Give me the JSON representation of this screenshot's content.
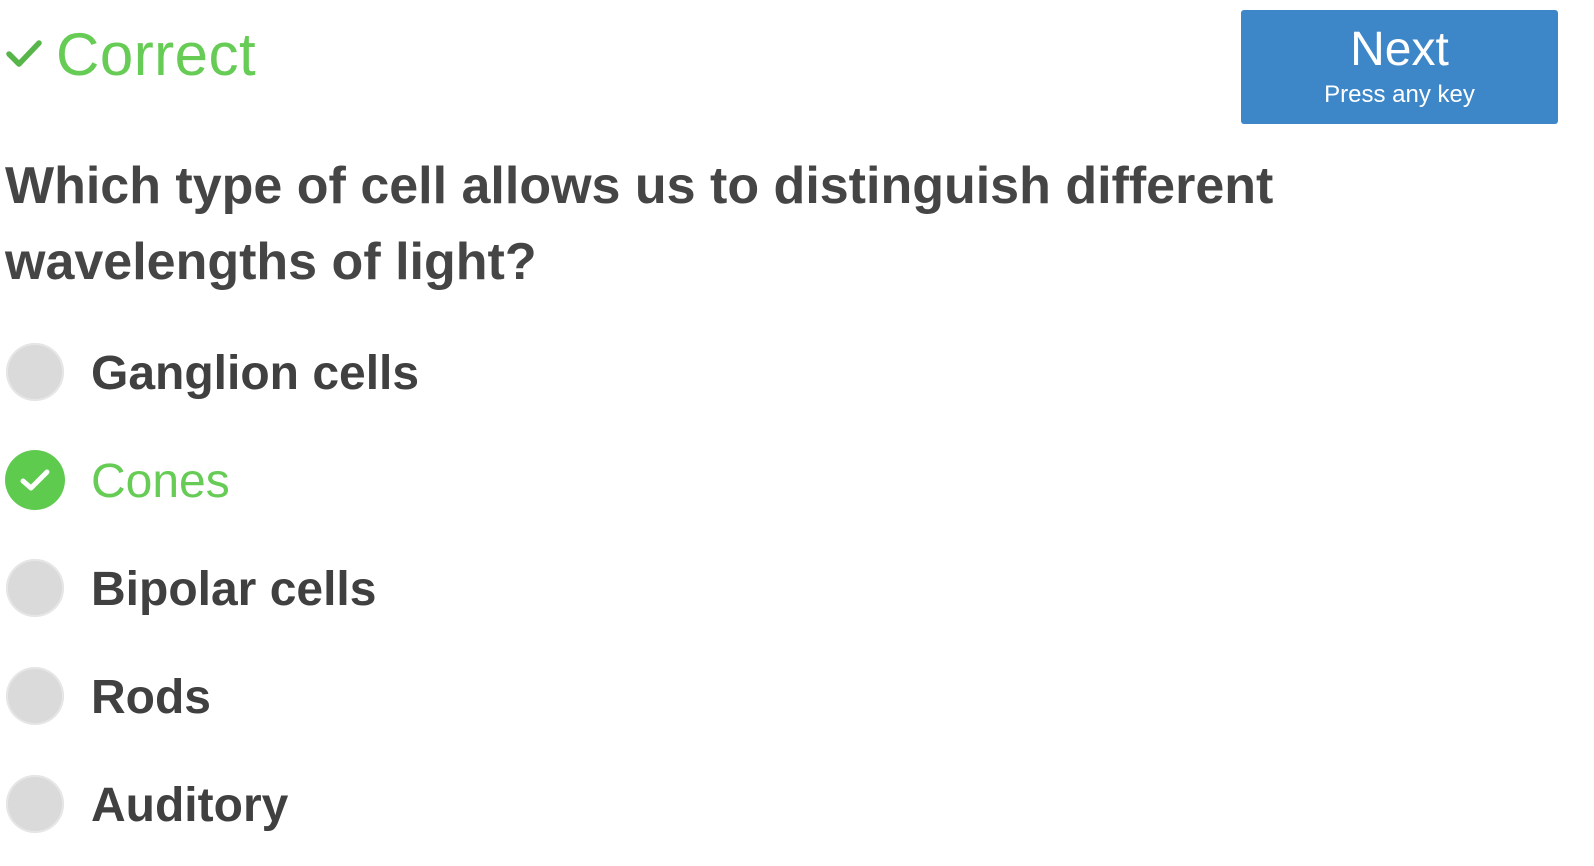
{
  "status": {
    "text": "Correct",
    "icon": "checkmark-icon",
    "color": "#66cc55"
  },
  "next_button": {
    "label": "Next",
    "hint": "Press any key",
    "color": "#3d87c9"
  },
  "question": {
    "text": "Which type of cell allows us to distinguish different wavelengths of light?"
  },
  "options": [
    {
      "label": "Ganglion cells",
      "selected": false
    },
    {
      "label": "Cones",
      "selected": true,
      "correct": true
    },
    {
      "label": "Bipolar cells",
      "selected": false
    },
    {
      "label": "Rods",
      "selected": false
    },
    {
      "label": "Auditory",
      "selected": false
    }
  ],
  "colors": {
    "correct_green": "#66cc55",
    "text_dark": "#454545",
    "radio_unselected": "#dadada"
  }
}
